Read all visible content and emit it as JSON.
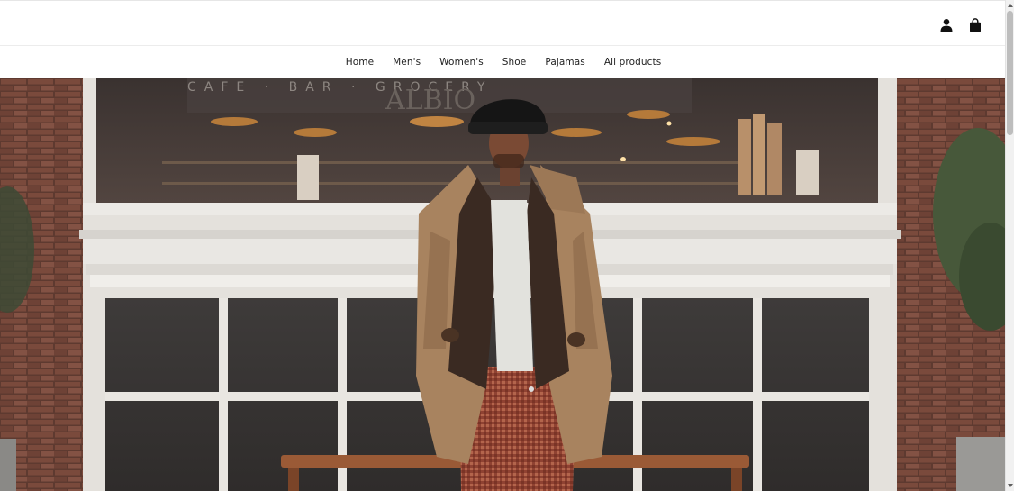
{
  "header": {
    "account_icon": "user-icon",
    "cart_icon": "shopping-bag-icon"
  },
  "nav": {
    "items": [
      {
        "label": "Home"
      },
      {
        "label": "Men's"
      },
      {
        "label": "Women's"
      },
      {
        "label": "Shoe"
      },
      {
        "label": "Pajamas"
      },
      {
        "label": "All products"
      }
    ]
  },
  "hero": {
    "storefront_sign": "CAFE · BAR · GROCERY",
    "storefront_name": "ALBIO"
  },
  "colors": {
    "text": "#222222",
    "background": "#ffffff",
    "brick": "#6b3f34",
    "window_frame": "#e8e6e2",
    "coat": "#a98563",
    "trousers": "#9a4a36"
  }
}
